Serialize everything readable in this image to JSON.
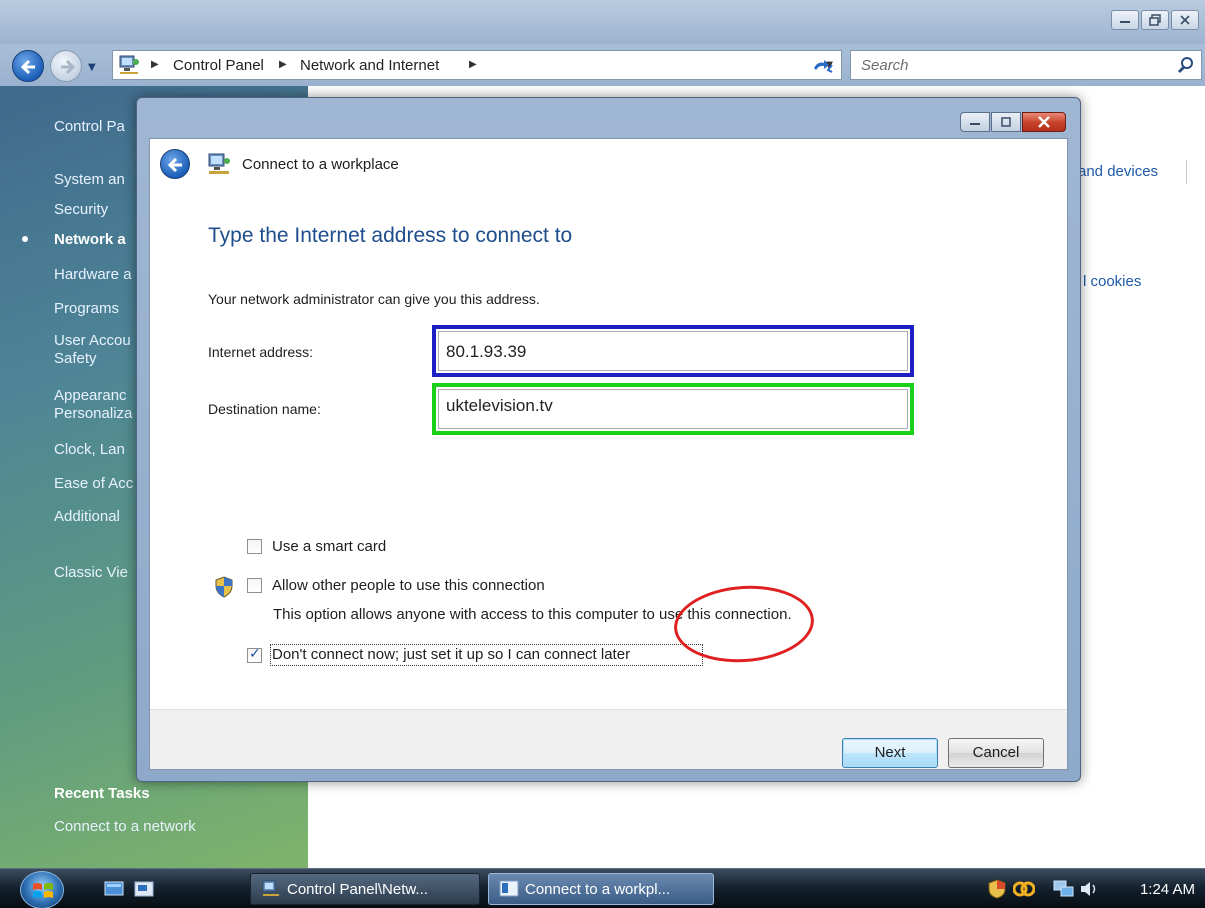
{
  "explorer": {
    "breadcrumb": [
      "Control Panel",
      "Network and Internet"
    ],
    "search_placeholder": "Search"
  },
  "left_pane": {
    "items": [
      "Control Pa",
      "System an",
      "Security",
      "Network a",
      "Hardware a",
      "Programs",
      "User Accou",
      "Safety",
      "Appearanc",
      "Personaliza",
      "Clock, Lan",
      "Ease of Acc",
      "Additional",
      "Classic Vie"
    ],
    "recent_tasks_heading": "Recent Tasks",
    "recent_tasks": [
      "Connect to a network"
    ]
  },
  "background_text": {
    "devices": "and devices",
    "cookies": "l cookies"
  },
  "dialog": {
    "title": "Connect to a workplace",
    "heading": "Type the Internet address to connect to",
    "instruction": "Your network administrator can give you this address.",
    "internet_address_label": "Internet address:",
    "internet_address_value": "80.1.93.39",
    "destination_name_label": "Destination name:",
    "destination_name_value": "uktelevision.tv",
    "options": [
      {
        "label": "Use a smart card",
        "checked": false
      },
      {
        "label": "Allow other people to use this connection",
        "checked": false
      },
      {
        "label": "Don't connect now; just set it up so I can connect later",
        "checked": true
      }
    ],
    "allow_description": "This option allows anyone with access to this computer to use this connection.",
    "next_label": "Next",
    "cancel_label": "Cancel",
    "annotation_colors": {
      "address": "#1c1fc4",
      "destination": "#19d119",
      "next": "#e02020"
    }
  },
  "taskbar": {
    "buttons": [
      "Control Panel\\Netw...",
      "Connect to a workpl..."
    ],
    "clock": "1:24 AM"
  }
}
